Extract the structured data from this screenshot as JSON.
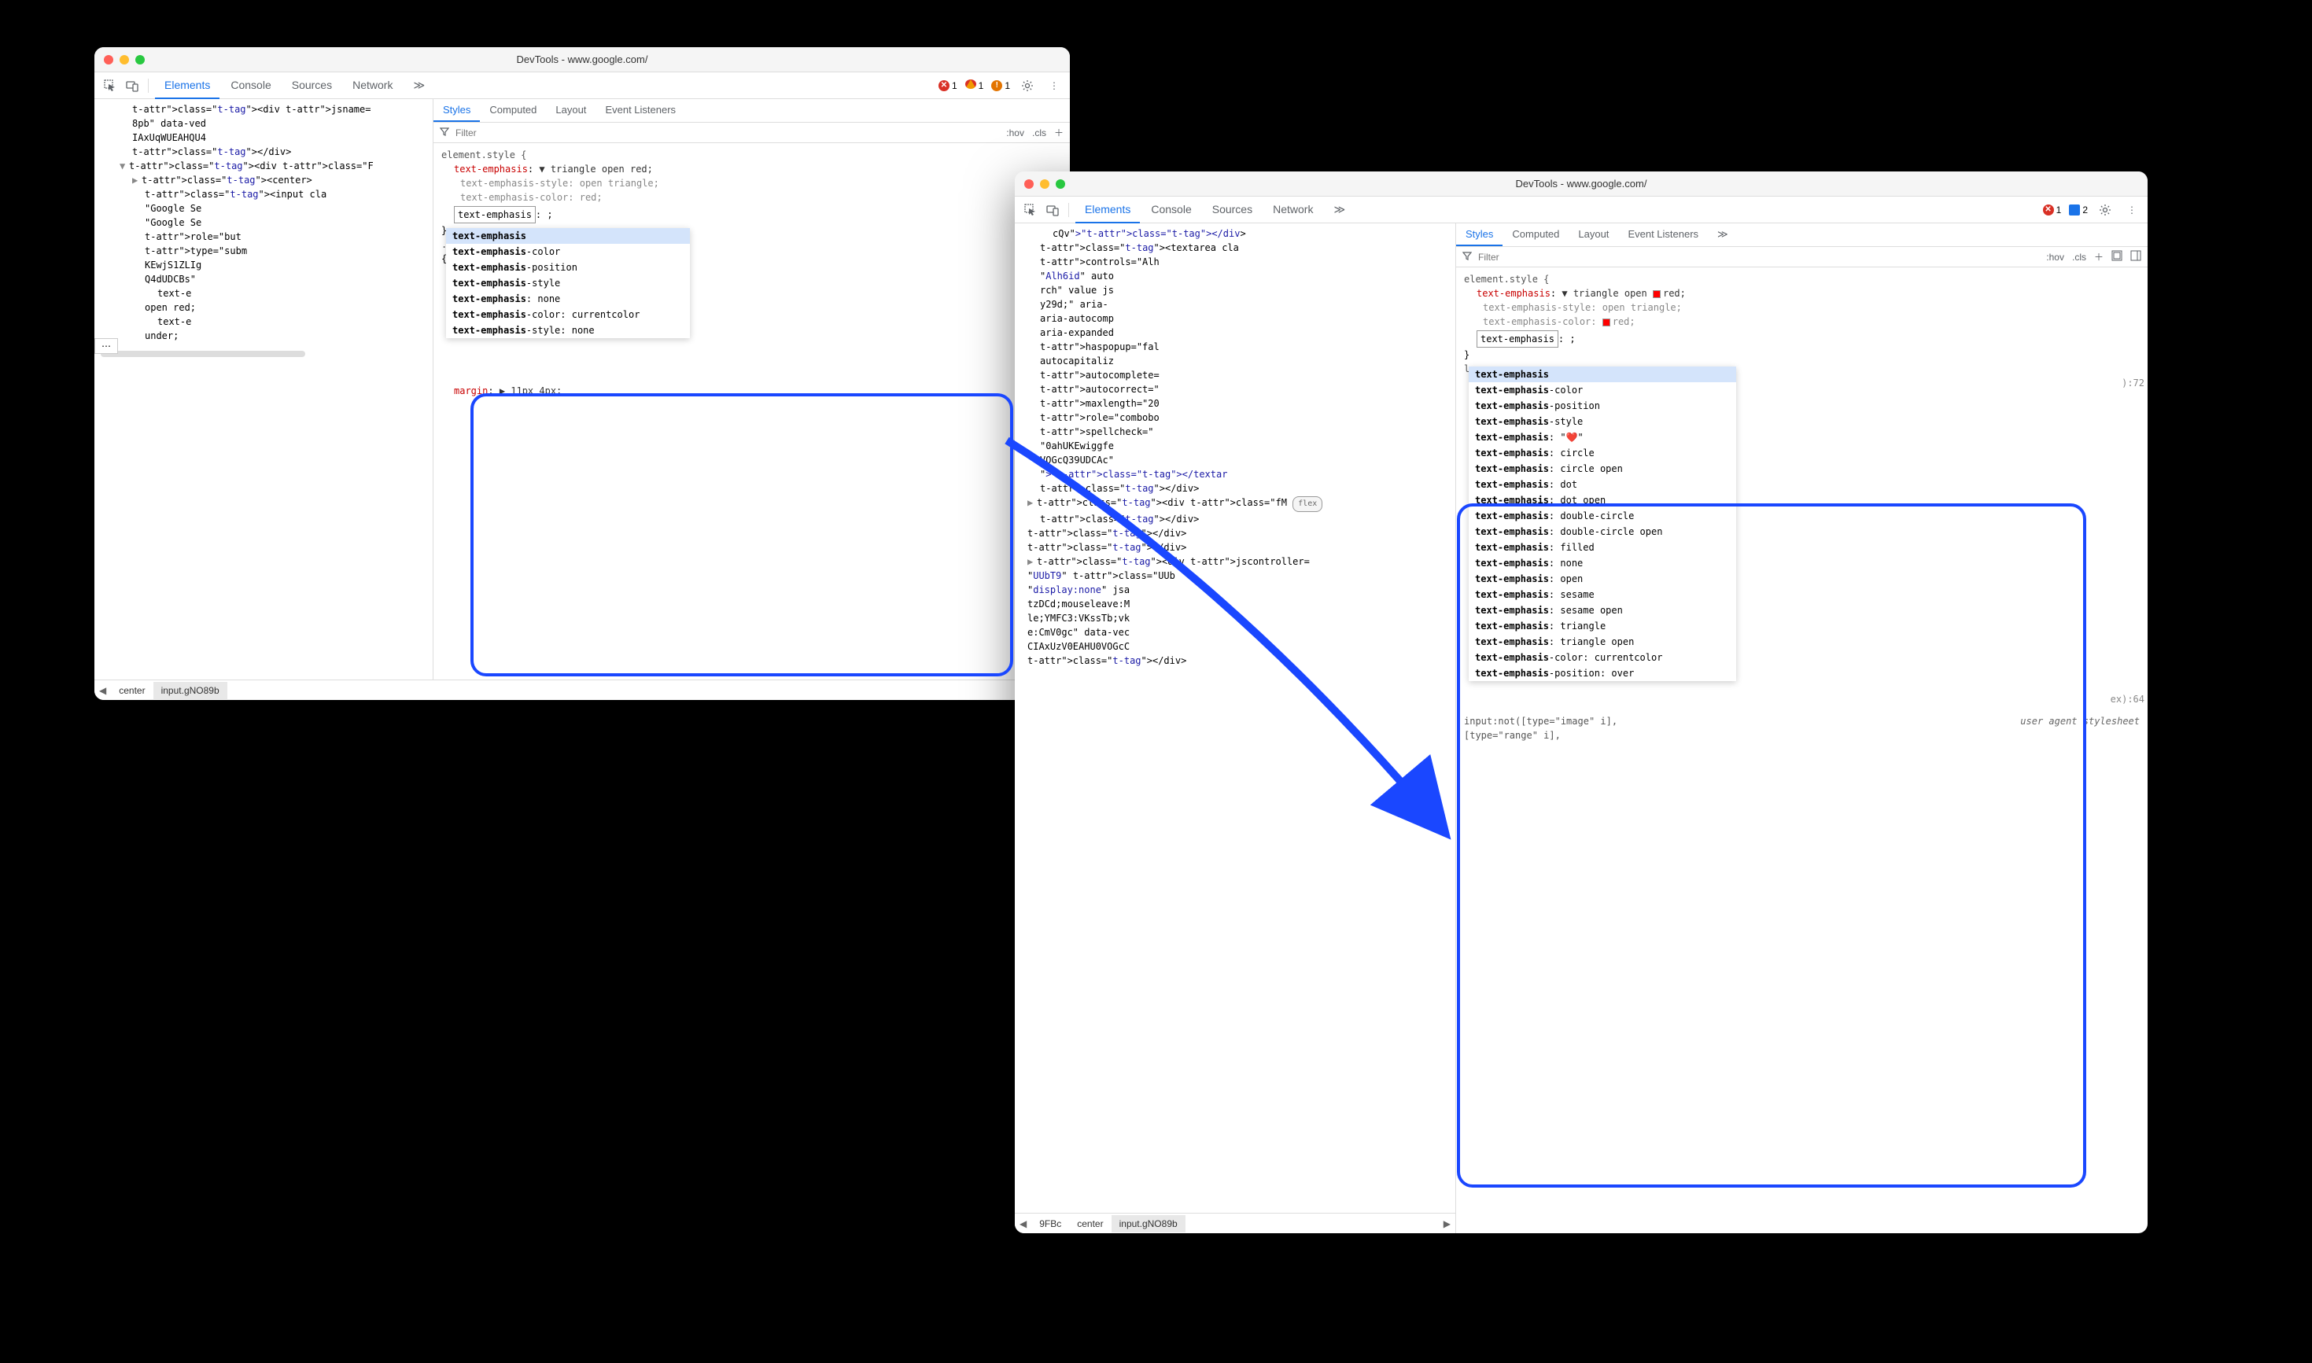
{
  "window_title": "DevTools - www.google.com/",
  "main_tabs": [
    "Elements",
    "Console",
    "Sources",
    "Network"
  ],
  "subtabs": [
    "Styles",
    "Computed",
    "Layout",
    "Event Listeners"
  ],
  "filter_placeholder": "Filter",
  "filter_hov": ":hov",
  "filter_cls": ".cls",
  "left": {
    "errors": "1",
    "warnings": "1",
    "info": "1",
    "dom_lines": [
      {
        "indent": 2,
        "text": "<div jsname="
      },
      {
        "indent": 2,
        "text": "8pb\" data-ved"
      },
      {
        "indent": 2,
        "text": "IAxUqWUEAHQU4"
      },
      {
        "indent": 2,
        "text": "</div>"
      },
      {
        "indent": 1,
        "expand": "▼",
        "text": "<div class=\"F"
      },
      {
        "indent": 2,
        "expand": "▶",
        "text": "<center>"
      },
      {
        "indent": 3,
        "text": "<input cla"
      },
      {
        "indent": 3,
        "text": "\"Google Se"
      },
      {
        "indent": 3,
        "text": "\"Google Se"
      },
      {
        "indent": 3,
        "text": "role=\"but"
      },
      {
        "indent": 3,
        "text": "type=\"subm"
      },
      {
        "indent": 3,
        "text": "KEwjS1ZLIg"
      },
      {
        "indent": 3,
        "text": "Q4dUDCBs\""
      },
      {
        "indent": 4,
        "text": "text-e"
      },
      {
        "indent": 3,
        "text": "open red;"
      },
      {
        "indent": 4,
        "text": "text-e"
      },
      {
        "indent": 3,
        "text": "under;"
      }
    ],
    "styles_header": "element.style {",
    "style_main": {
      "prop": "text-emphasis",
      "val": "▼ triangle open red;"
    },
    "style_sub1": {
      "prop": "text-emphasis-style",
      "val": "open triangle;"
    },
    "style_sub2": {
      "prop": "text-emphasis-color",
      "val": "red;"
    },
    "editing": "text-emphasis",
    "editing_suffix": ": ;",
    "brace": "}",
    "lsel": ".l",
    "lbrace": "{",
    "autocomplete": [
      "text-emphasis",
      "text-emphasis-color",
      "text-emphasis-position",
      "text-emphasis-style",
      "text-emphasis: none",
      "text-emphasis-color: currentcolor",
      "text-emphasis-style: none"
    ],
    "after_margin": {
      "prop": "margin",
      "val": "▶ 11px 4px;"
    },
    "breadcrumb": [
      "center",
      "input.gNO89b"
    ]
  },
  "right": {
    "errors": "1",
    "messages": "2",
    "dom_lines": [
      {
        "indent": 2,
        "text": "cQv\"></div>"
      },
      {
        "indent": 1,
        "text": "<textarea cla"
      },
      {
        "indent": 1,
        "text": "controls=\"Alh"
      },
      {
        "indent": 1,
        "text": "\"Alh6id\" auto"
      },
      {
        "indent": 1,
        "text": "rch\" value js"
      },
      {
        "indent": 1,
        "text": "y29d;\" aria-"
      },
      {
        "indent": 1,
        "text": "aria-autocomp"
      },
      {
        "indent": 1,
        "text": "aria-expanded"
      },
      {
        "indent": 1,
        "text": "haspopup=\"fal"
      },
      {
        "indent": 1,
        "text": "autocapitaliz"
      },
      {
        "indent": 1,
        "text": "autocomplete="
      },
      {
        "indent": 1,
        "text": "autocorrect=\""
      },
      {
        "indent": 1,
        "text": "maxlength=\"20"
      },
      {
        "indent": 1,
        "text": "role=\"combobo"
      },
      {
        "indent": 1,
        "text": "spellcheck=\""
      },
      {
        "indent": 1,
        "text": "\"0ahUKEwiggfe"
      },
      {
        "indent": 1,
        "text": "VOGcQ39UDCAc\""
      },
      {
        "indent": 1,
        "text": "\"></textar"
      },
      {
        "indent": 1,
        "text": "</div>"
      },
      {
        "indent": 0,
        "expand": "▶",
        "text": "<div class=\"fM",
        "flex": true
      },
      {
        "indent": 1,
        "text": "</div>"
      },
      {
        "indent": 0,
        "text": "</div>"
      },
      {
        "indent": 0,
        "text": "</div>"
      },
      {
        "indent": 0,
        "expand": "▶",
        "text": "<div jscontroller="
      },
      {
        "indent": 0,
        "text": "\"UUbT9\" class=\"UUb"
      },
      {
        "indent": 0,
        "text": "\"display:none\" jsa"
      },
      {
        "indent": 0,
        "text": "tzDCd;mouseleave:M"
      },
      {
        "indent": 0,
        "text": "le;YMFC3:VKssTb;vk"
      },
      {
        "indent": 0,
        "text": "e:CmV0gc\" data-vec"
      },
      {
        "indent": 0,
        "text": "CIAxUzV0EAHU0VOGcC"
      },
      {
        "indent": 0,
        "text": "</div>"
      }
    ],
    "styles_header": "element.style {",
    "style_main2": {
      "prop": "text-emphasis",
      "val": "▼ triangle open ",
      "swatch": true,
      "val2": "red;"
    },
    "style_sub1b": {
      "prop": "text-emphasis-style",
      "val": "open triangle;"
    },
    "style_sub2b": {
      "prop": "text-emphasis-color",
      "swatch": true,
      "val": "red;"
    },
    "editing2": "text-emphasis",
    "editing2_suffix": ": ;",
    "brace2": "}",
    "lbrace2": "l",
    "side_annot1": "):72",
    "side_annot2": "ex):64",
    "autocomplete": [
      "text-emphasis",
      "text-emphasis-color",
      "text-emphasis-position",
      "text-emphasis-style",
      "text-emphasis: \"❤️\"",
      "text-emphasis: circle",
      "text-emphasis: circle open",
      "text-emphasis: dot",
      "text-emphasis: dot open",
      "text-emphasis: double-circle",
      "text-emphasis: double-circle open",
      "text-emphasis: filled",
      "text-emphasis: none",
      "text-emphasis: open",
      "text-emphasis: sesame",
      "text-emphasis: sesame open",
      "text-emphasis: triangle",
      "text-emphasis: triangle open",
      "text-emphasis-color: currentcolor",
      "text-emphasis-position: over"
    ],
    "footer_line1": "input:not([type=\"image\" i],",
    "footer_line2": "[type=\"range\" i],",
    "footer_note": "user agent stylesheet",
    "breadcrumb": [
      "9FBc",
      "center",
      "input.gNO89b"
    ]
  }
}
